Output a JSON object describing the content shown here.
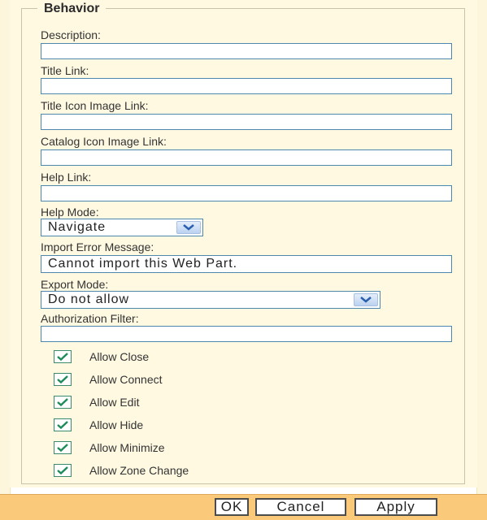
{
  "section": {
    "legend": "Behavior"
  },
  "fields": {
    "description": {
      "label": "Description:",
      "value": ""
    },
    "title_link": {
      "label": "Title Link:",
      "value": ""
    },
    "title_icon_image_link": {
      "label": "Title Icon Image Link:",
      "value": ""
    },
    "catalog_icon_image_link": {
      "label": "Catalog Icon Image Link:",
      "value": ""
    },
    "help_link": {
      "label": "Help Link:",
      "value": ""
    },
    "help_mode": {
      "label": "Help Mode:",
      "selected": "Navigate"
    },
    "import_error_message": {
      "label": "Import Error Message:",
      "value": "Cannot import this Web Part."
    },
    "export_mode": {
      "label": "Export Mode:",
      "selected": "Do not allow"
    },
    "authorization_filter": {
      "label": "Authorization Filter:",
      "value": ""
    }
  },
  "checkboxes": [
    {
      "label": "Allow Close",
      "checked": true
    },
    {
      "label": "Allow Connect",
      "checked": true
    },
    {
      "label": "Allow Edit",
      "checked": true
    },
    {
      "label": "Allow Hide",
      "checked": true
    },
    {
      "label": "Allow Minimize",
      "checked": true
    },
    {
      "label": "Allow Zone Change",
      "checked": true
    }
  ],
  "footer": {
    "ok_label": "OK",
    "cancel_label": "Cancel",
    "apply_label": "Apply"
  },
  "colors": {
    "panel_background": "#fff9e2",
    "footer_background": "#fbc97a",
    "input_border": "#4e87ad",
    "check_mark": "#1f8a5a"
  },
  "icons": {
    "dropdown": "chevron-down-icon",
    "checkbox": "check-icon"
  }
}
